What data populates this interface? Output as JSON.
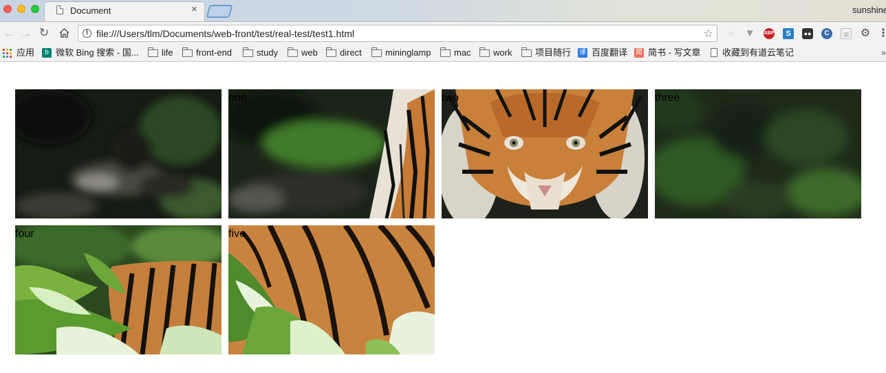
{
  "window": {
    "tab_title": "Document",
    "tab_close": "×",
    "profile_name": "sunshine"
  },
  "toolbar": {
    "back": "←",
    "forward": "→",
    "reload": "↻",
    "url": "file:///Users/tlm/Documents/web-front/test/real-test/test1.html",
    "star": "☆",
    "extensions": [
      "reader-icon",
      "vpn-icon",
      "adblock-plus-icon",
      "s-extension-icon",
      "tampermonkey-icon",
      "c-extension-icon",
      "grid-extension-icon",
      "gear-icon",
      "menu-icon"
    ],
    "abp_text": "ABP"
  },
  "bookmarks": {
    "items": [
      {
        "label": "应用",
        "icon": "apps-grid-icon"
      },
      {
        "label": "微软 Bing 搜索 - 国...",
        "icon": "bing-icon"
      },
      {
        "label": "life",
        "icon": "folder-icon"
      },
      {
        "label": "front-end",
        "icon": "folder-icon"
      },
      {
        "label": "study",
        "icon": "folder-icon"
      },
      {
        "label": "web",
        "icon": "folder-icon"
      },
      {
        "label": "direct",
        "icon": "folder-icon"
      },
      {
        "label": "mininglamp",
        "icon": "folder-icon"
      },
      {
        "label": "mac",
        "icon": "folder-icon"
      },
      {
        "label": "work",
        "icon": "folder-icon"
      },
      {
        "label": "项目随行",
        "icon": "folder-icon"
      },
      {
        "label": "百度翻译",
        "icon": "translate-icon"
      },
      {
        "label": "简书 - 写文章",
        "icon": "jianshu-icon"
      },
      {
        "label": "收藏到有道云笔记",
        "icon": "page-icon"
      }
    ],
    "translate_glyph": "译",
    "jianshu_glyph": "简",
    "more": "»"
  },
  "page": {
    "tiles": [
      {
        "label": "",
        "content": "blurred jungle background"
      },
      {
        "label": "one",
        "content": "tiger head edge in foliage"
      },
      {
        "label": "two",
        "content": "tiger face"
      },
      {
        "label": "three",
        "content": "blurred green foliage"
      },
      {
        "label": "four",
        "content": "tiger body in leaves"
      },
      {
        "label": "five",
        "content": "tiger body in leaves"
      }
    ]
  },
  "colors": {
    "tiger_orange": "#c9843f",
    "foliage_green": "#3f6b2a",
    "dark_jungle": "#1e2a1c"
  }
}
